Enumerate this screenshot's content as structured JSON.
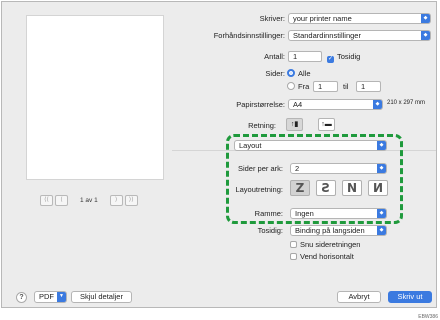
{
  "printer": {
    "label": "Skriver:",
    "value": "your printer name"
  },
  "presets": {
    "label": "Forhåndsinnstillinger:",
    "value": "Standardinnstillinger"
  },
  "copies": {
    "label": "Antall:",
    "value": "1",
    "duplex_label": "Tosidig",
    "duplex_checked": true
  },
  "pages": {
    "label": "Sider:",
    "all_label": "Alle",
    "from_label": "Fra",
    "from_value": "1",
    "to_label": "til",
    "to_value": "1"
  },
  "paper": {
    "label": "Papirstørrelse:",
    "value": "A4",
    "size_text": "210 x 297 mm"
  },
  "orientation": {
    "label": "Retning:",
    "portrait_icon": "portrait-orientation-icon",
    "landscape_icon": "landscape-orientation-icon"
  },
  "section": {
    "value": "Layout"
  },
  "layout": {
    "pages_per_sheet_label": "Sider per ark:",
    "pages_per_sheet_value": "2",
    "direction_label": "Layoutretning:",
    "directions": [
      "Z",
      "Ƨ",
      "N",
      "И"
    ],
    "border_label": "Ramme:",
    "border_value": "Ingen",
    "two_sided_label": "Tosidig:",
    "two_sided_value": "Binding på langsiden",
    "reverse_label": "Snu sideretningen",
    "flip_label": "Vend horisontalt"
  },
  "preview": {
    "page_label": "1 av 1",
    "first": "⟨⟨",
    "prev": "⟨",
    "next": "⟩",
    "last": "⟩⟩"
  },
  "footer": {
    "help": "?",
    "pdf": "PDF",
    "details": "Skjul detaljer",
    "cancel": "Avbryt",
    "print": "Skriv ut"
  },
  "figure_code": "EBW386",
  "colors": {
    "accent": "#3b7ae0",
    "highlight": "#1f9a3c"
  }
}
